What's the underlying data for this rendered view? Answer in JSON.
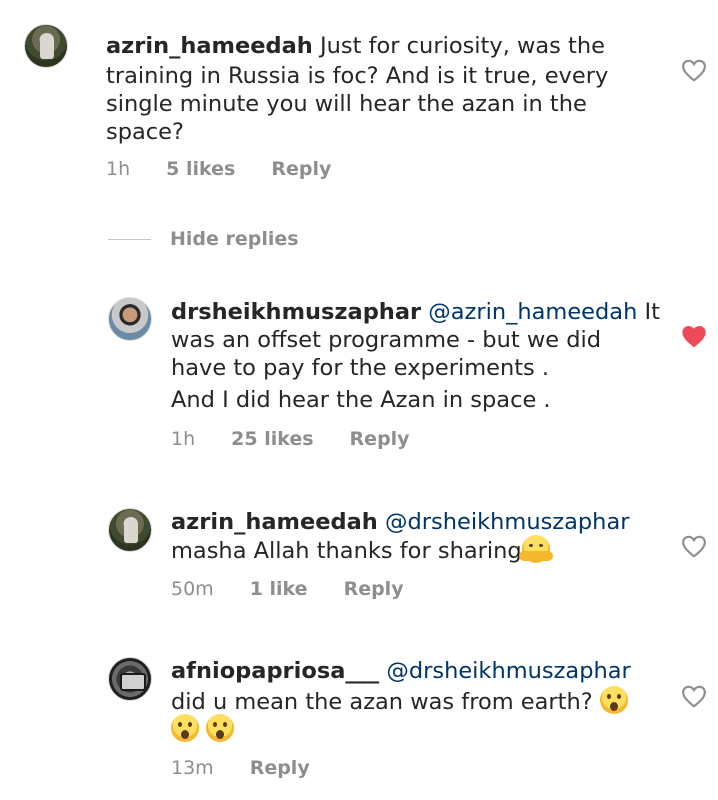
{
  "comments": [
    {
      "username": "azrin_hameedah",
      "lines": [
        "Just for curiosity, was the",
        "training in Russia is foc? And is it true, every",
        "single minute you will hear the azan in the",
        "space?"
      ],
      "time": "1h",
      "likes": "5 likes",
      "reply_label": "Reply",
      "liked": false
    }
  ],
  "hide_replies_label": "Hide replies",
  "replies": [
    {
      "username": "drsheikhmuszaphar",
      "mention": "@azrin_hameedah",
      "lines": [
        "It",
        "was an offset programme - but we did",
        "have to pay for the experiments .",
        "And I did hear the Azan in space ."
      ],
      "time": "1h",
      "likes": "25 likes",
      "reply_label": "Reply",
      "liked": true
    },
    {
      "username": "azrin_hameedah",
      "mention": "@drsheikhmuszaphar",
      "lines": [
        "masha Allah thanks for sharing"
      ],
      "time": "50m",
      "likes": "1 like",
      "reply_label": "Reply",
      "liked": false
    },
    {
      "username": "afniopapriosa___",
      "mention": "@drsheikhmuszaphar",
      "lines": [
        "did u mean the azan was from earth?"
      ],
      "time": "13m",
      "reply_label": "Reply",
      "liked": false
    }
  ],
  "icons": {
    "heart_outline": "heart-outline-icon",
    "heart_filled": "heart-filled-icon",
    "emoji_hug": "hugging-face-emoji",
    "emoji_wow": "surprised-face-emoji"
  },
  "colors": {
    "text": "#262626",
    "meta": "#8e8e8e",
    "mention": "#003569",
    "liked_heart": "#ed4956"
  }
}
